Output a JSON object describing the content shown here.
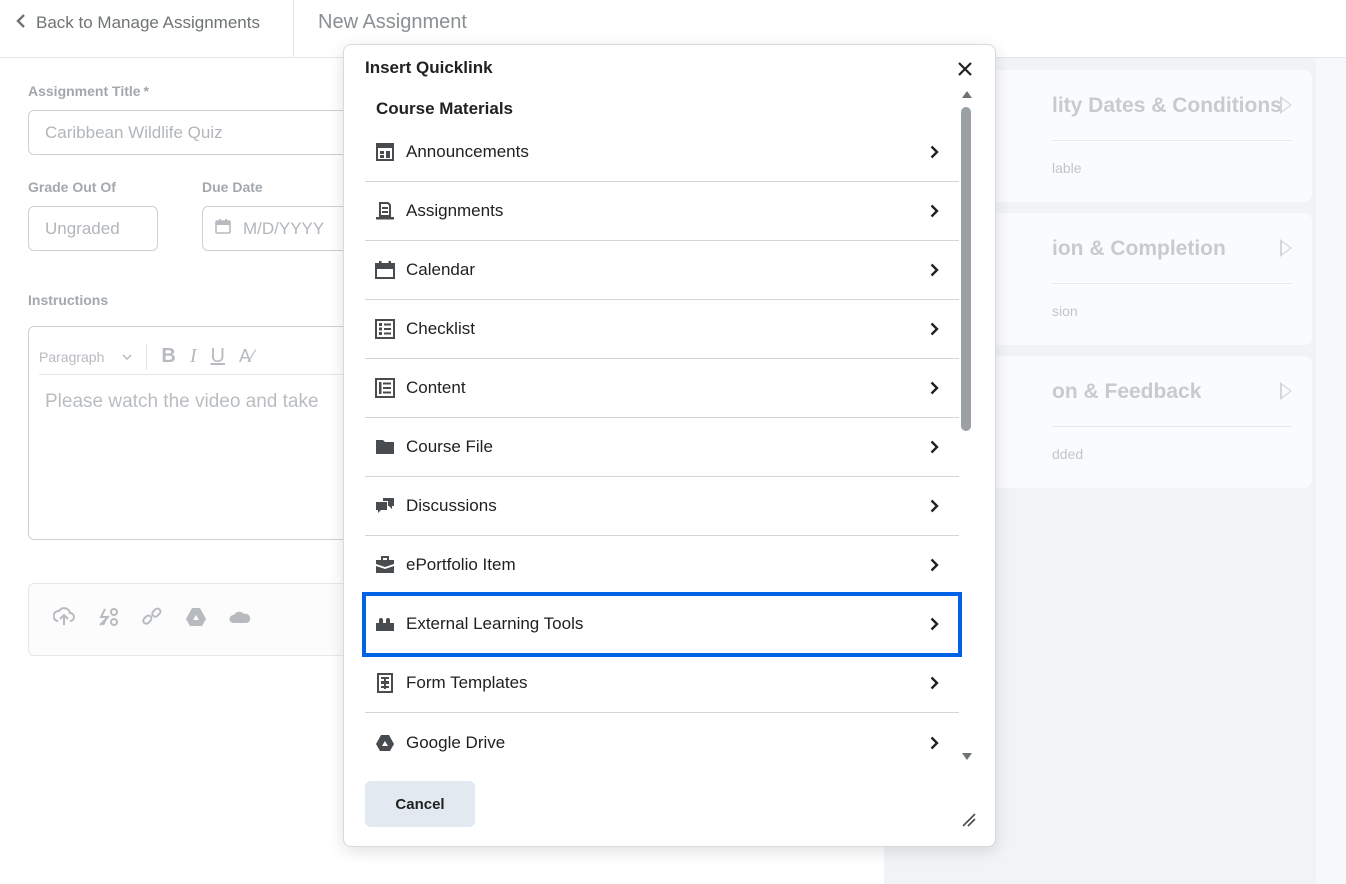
{
  "page": {
    "back_link": "Back to Manage Assignments",
    "heading": "New Assignment",
    "assignment_title_label": "Assignment Title",
    "required_marker": "*",
    "assignment_title_value": "Caribbean Wildlife Quiz",
    "grade_label": "Grade Out Of",
    "grade_placeholder": "Ungraded",
    "due_label": "Due Date",
    "due_placeholder": "M/D/YYYY",
    "instructions_label": "Instructions",
    "format_select": "Paragraph",
    "editor_text": "Please watch the video and take",
    "right_cards": [
      {
        "title": "lity Dates & Conditions",
        "sub": "lable"
      },
      {
        "title": "ion & Completion",
        "sub": "sion"
      },
      {
        "title": "on & Feedback",
        "sub": "dded"
      }
    ]
  },
  "modal": {
    "title": "Insert Quicklink",
    "section": "Course Materials",
    "items": [
      {
        "label": "Announcements",
        "icon": "announcements-icon"
      },
      {
        "label": "Assignments",
        "icon": "assignments-icon"
      },
      {
        "label": "Calendar",
        "icon": "calendar-icon"
      },
      {
        "label": "Checklist",
        "icon": "checklist-icon"
      },
      {
        "label": "Content",
        "icon": "content-icon"
      },
      {
        "label": "Course File",
        "icon": "folder-icon"
      },
      {
        "label": "Discussions",
        "icon": "discussions-icon"
      },
      {
        "label": "ePortfolio Item",
        "icon": "briefcase-icon"
      },
      {
        "label": "External Learning Tools",
        "icon": "puzzle-icon",
        "highlighted": true
      },
      {
        "label": "Form Templates",
        "icon": "form-icon"
      },
      {
        "label": "Google Drive",
        "icon": "google-drive-icon"
      }
    ],
    "cancel_label": "Cancel",
    "highlight_color": "#0063e6"
  }
}
